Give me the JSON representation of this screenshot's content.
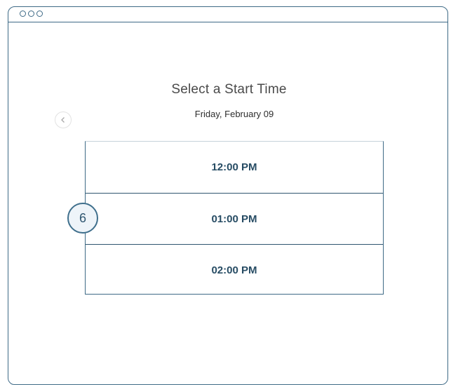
{
  "header": {
    "title": "Select a Start Time",
    "date": "Friday, February 09"
  },
  "time_slots": [
    {
      "label": "12:00 PM"
    },
    {
      "label": "01:00 PM"
    },
    {
      "label": "02:00 PM"
    }
  ],
  "step_badge": "6",
  "icons": {
    "back": "chevron-left-icon",
    "window_controls": "circle-icon"
  },
  "colors": {
    "accent": "#3e6a86",
    "slot_text": "#274c64",
    "badge_fill": "#eef4f9"
  }
}
